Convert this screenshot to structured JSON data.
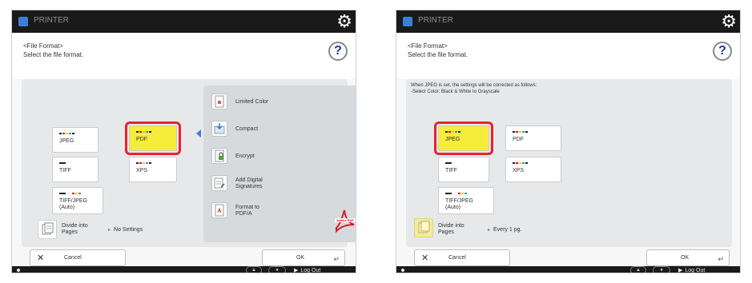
{
  "colors": {
    "topbar": "#1a1a1a",
    "accent_blue": "#3d7fd6",
    "selected_fill": "#f6ec3c",
    "selected_outline": "#e5242e"
  },
  "left": {
    "app_name": "PRINTER",
    "header": {
      "title": "<File Format>",
      "subtitle": "Select the file format."
    },
    "formats": [
      {
        "label": "JPEG",
        "selected": false
      },
      {
        "label": "PDF",
        "selected": true
      },
      {
        "label": "TIFF",
        "selected": false
      },
      {
        "label": "XPS",
        "selected": false
      },
      {
        "label": "TIFF/JPEG\n(Auto)",
        "selected": false
      }
    ],
    "divide": {
      "label": "Divide into\nPages",
      "value": "No Settings"
    },
    "options": [
      {
        "label": "Limited Color",
        "icon": "limited-color-icon"
      },
      {
        "label": "Compact",
        "icon": "compact-icon"
      },
      {
        "label": "Encrypt",
        "icon": "encrypt-icon"
      },
      {
        "label": "Add Digital\nSignatures",
        "icon": "digital-signature-icon"
      },
      {
        "label": "Format to\nPDF/A",
        "icon": "pdfa-icon"
      }
    ],
    "footer": {
      "cancel": "Cancel",
      "ok": "OK"
    },
    "status": {
      "logout": "Log Out"
    }
  },
  "right": {
    "app_name": "PRINTER",
    "header": {
      "title": "<File Format>",
      "subtitle": "Select the file format."
    },
    "notice": "When JPEG is set, the settings will be corrected as follows:\n-Select Color: Black & White to Grayscale",
    "formats": [
      {
        "label": "JPEG",
        "selected": true
      },
      {
        "label": "PDF",
        "selected": false
      },
      {
        "label": "TIFF",
        "selected": false
      },
      {
        "label": "XPS",
        "selected": false
      },
      {
        "label": "TIFF/JPEG\n(Auto)",
        "selected": false
      }
    ],
    "divide": {
      "label": "Divide into\nPages",
      "value": "Every 1 pg."
    },
    "footer": {
      "cancel": "Cancel",
      "ok": "OK"
    },
    "status": {
      "logout": "Log Out"
    }
  }
}
